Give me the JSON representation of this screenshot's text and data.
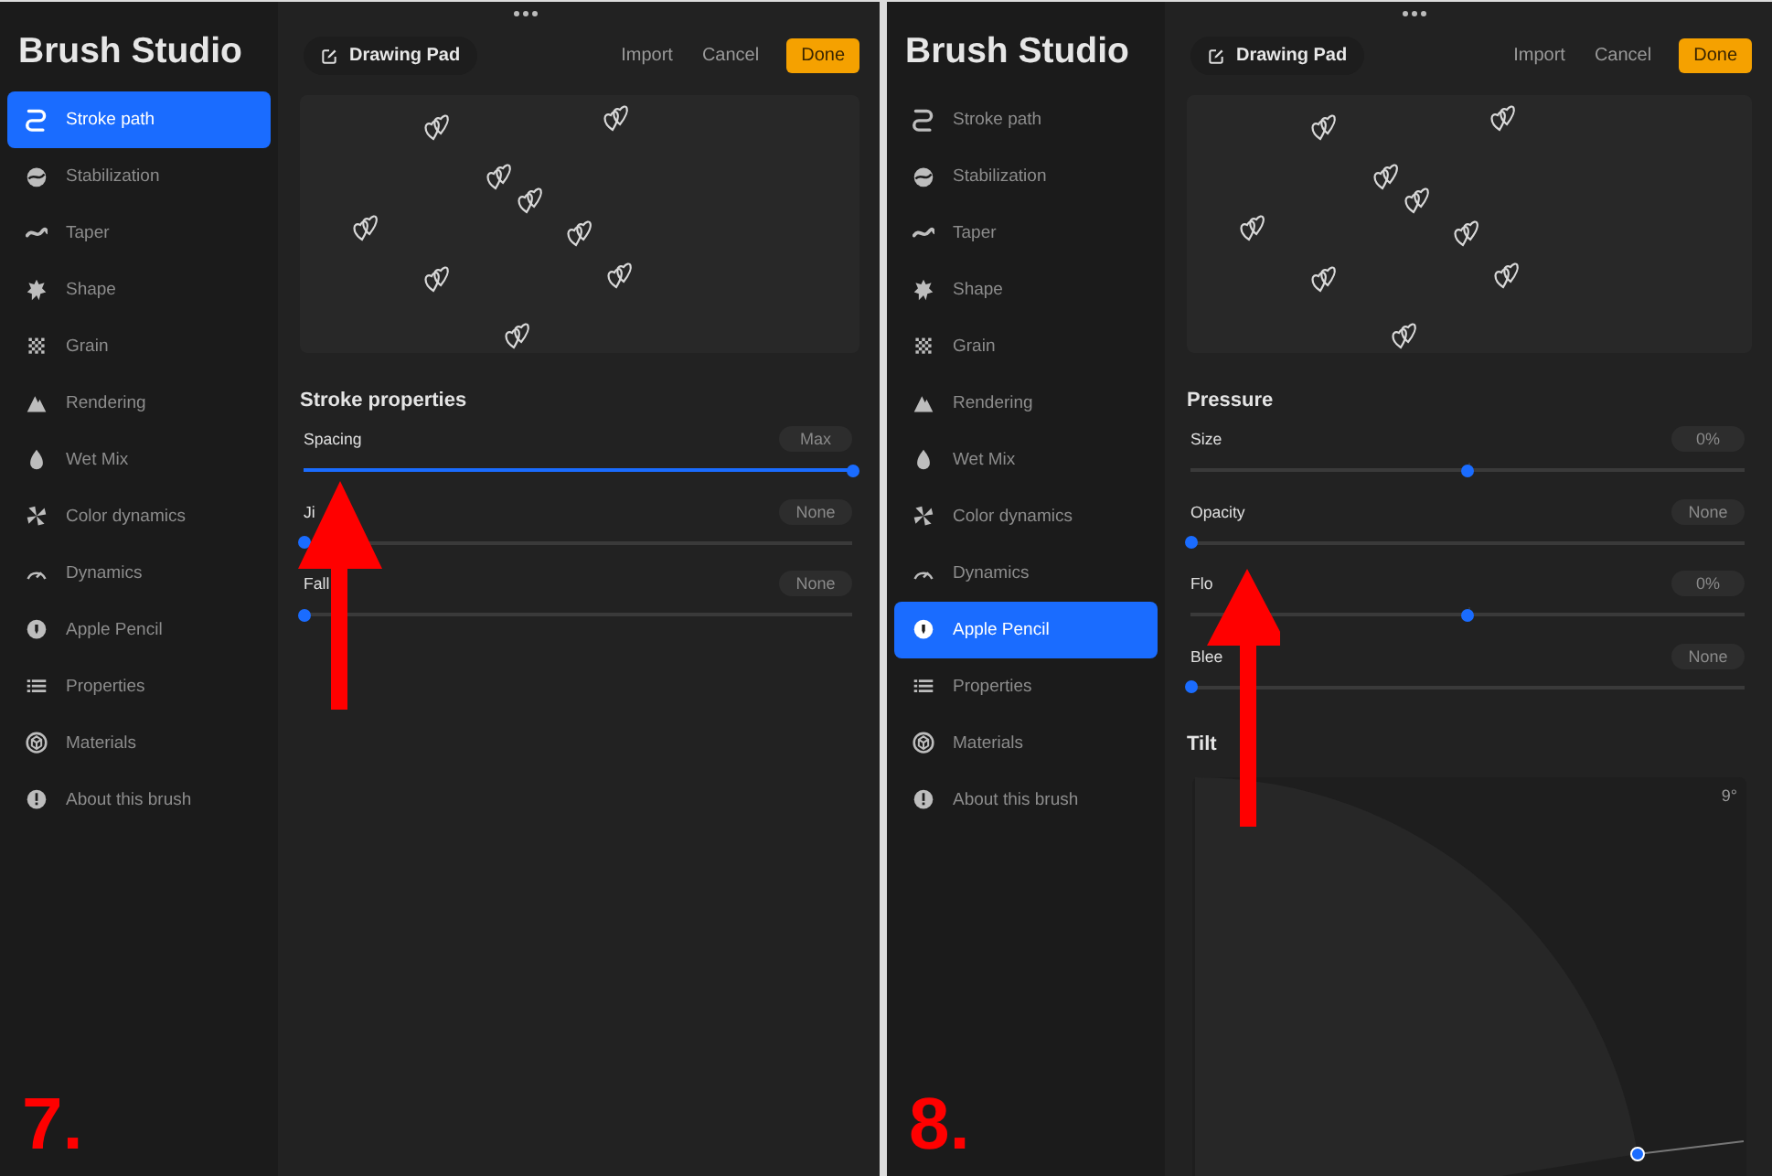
{
  "panels": [
    {
      "annotation": "7.",
      "sidebar": {
        "title": "Brush Studio",
        "items": [
          {
            "label": "Stroke path",
            "selected": true
          },
          {
            "label": "Stabilization",
            "selected": false
          },
          {
            "label": "Taper",
            "selected": false
          },
          {
            "label": "Shape",
            "selected": false
          },
          {
            "label": "Grain",
            "selected": false
          },
          {
            "label": "Rendering",
            "selected": false
          },
          {
            "label": "Wet Mix",
            "selected": false
          },
          {
            "label": "Color dynamics",
            "selected": false
          },
          {
            "label": "Dynamics",
            "selected": false
          },
          {
            "label": "Apple Pencil",
            "selected": false
          },
          {
            "label": "Properties",
            "selected": false
          },
          {
            "label": "Materials",
            "selected": false
          },
          {
            "label": "About this brush",
            "selected": false
          }
        ]
      },
      "header": {
        "title": "Drawing Pad",
        "actions": [
          "Import",
          "Cancel"
        ],
        "done": "Done"
      },
      "sections": [
        {
          "kind": "sliders",
          "title": "Stroke properties",
          "rows": [
            {
              "label": "Spacing",
              "value": "Max",
              "kind": "fill",
              "level": 1
            },
            {
              "label": "Ji",
              "value": "None",
              "kind": "fill",
              "level": 0
            },
            {
              "label": "Fall",
              "value": "None",
              "kind": "fill",
              "level": 0
            }
          ]
        }
      ]
    },
    {
      "annotation": "8.",
      "sidebar": {
        "title": "Brush Studio",
        "items": [
          {
            "label": "Stroke path",
            "selected": false
          },
          {
            "label": "Stabilization",
            "selected": false
          },
          {
            "label": "Taper",
            "selected": false
          },
          {
            "label": "Shape",
            "selected": false
          },
          {
            "label": "Grain",
            "selected": false
          },
          {
            "label": "Rendering",
            "selected": false
          },
          {
            "label": "Wet Mix",
            "selected": false
          },
          {
            "label": "Color dynamics",
            "selected": false
          },
          {
            "label": "Dynamics",
            "selected": false
          },
          {
            "label": "Apple Pencil",
            "selected": true
          },
          {
            "label": "Properties",
            "selected": false
          },
          {
            "label": "Materials",
            "selected": false
          },
          {
            "label": "About this brush",
            "selected": false
          }
        ]
      },
      "header": {
        "title": "Drawing Pad",
        "actions": [
          "Import",
          "Cancel"
        ],
        "done": "Done"
      },
      "sections": [
        {
          "kind": "sliders",
          "title": "Pressure",
          "rows": [
            {
              "label": "Size",
              "value": "0%",
              "kind": "centered",
              "level": 0.5
            },
            {
              "label": "Opacity",
              "value": "None",
              "kind": "fill",
              "level": 0
            },
            {
              "label": "Flo",
              "value": "0%",
              "kind": "centered",
              "level": 0.5
            },
            {
              "label": "Blee",
              "value": "None",
              "kind": "fill",
              "level": 0
            }
          ]
        },
        {
          "kind": "tilt",
          "title": "Tilt",
          "reading": "9°"
        }
      ]
    }
  ]
}
